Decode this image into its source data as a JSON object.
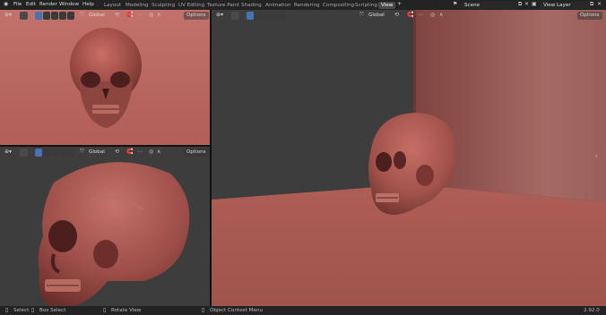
{
  "menu": {
    "file": "File",
    "edit": "Edit",
    "render": "Render",
    "window": "Window",
    "help": "Help"
  },
  "tabs": [
    "Layout",
    "Modeling",
    "Sculpting",
    "UV Editing",
    "Texture Paint",
    "Shading",
    "Animation",
    "Rendering",
    "Compositing",
    "Scripting",
    "View"
  ],
  "scene": "Scene",
  "view_layer": "View Layer",
  "viewport_header": {
    "orientation": "Global",
    "options": "Options"
  },
  "status": {
    "select": "Select",
    "box_select": "Box Select",
    "rotate_view": "Rotate View",
    "context_menu": "Object Context Menu",
    "version": "2.92.0"
  },
  "colors": {
    "skull": "#a5524b",
    "floor": "#a35a53",
    "wall": "#8b4b48",
    "bg_dark": "#3d3d3d",
    "accent": "#4772b3"
  }
}
